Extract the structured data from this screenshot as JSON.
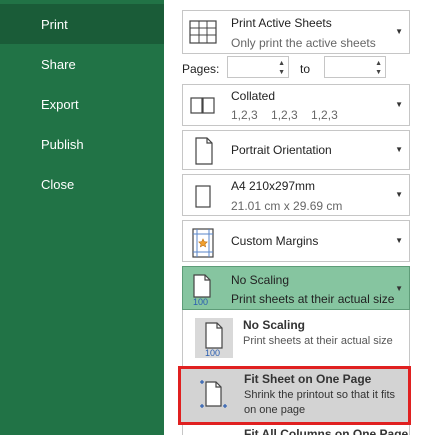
{
  "sidebar": {
    "items": [
      {
        "label": "Print",
        "active": true
      },
      {
        "label": "Share",
        "active": false
      },
      {
        "label": "Export",
        "active": false
      },
      {
        "label": "Publish",
        "active": false
      },
      {
        "label": "Close",
        "active": false
      }
    ]
  },
  "settings": {
    "print_what": {
      "label": "Print Active Sheets",
      "description": "Only print the active sheets"
    },
    "pages": {
      "label": "Pages:",
      "from": "",
      "to_label": "to",
      "to": ""
    },
    "collation": {
      "label": "Collated",
      "description": "1,2,3    1,2,3    1,2,3"
    },
    "orientation": {
      "label": "Portrait Orientation"
    },
    "paper_size": {
      "label": "A4 210x297mm",
      "description": "21.01 cm x 29.69 cm"
    },
    "margins": {
      "label": "Custom Margins"
    },
    "scaling": {
      "label": "No Scaling",
      "description": "Print sheets at their actual size"
    }
  },
  "scaling_options": [
    {
      "title": "No Scaling",
      "description": "Print sheets at their actual size",
      "icon_text": "100"
    },
    {
      "title": "Fit Sheet on One Page",
      "description": "Shrink the printout so that it fits on one page"
    },
    {
      "title": "Fit All Columns on One Page"
    }
  ],
  "colors": {
    "sidebar": "#217346",
    "sidebar_active": "#1a5c38",
    "selected_option": "#86c5a0",
    "highlight": "#e02020"
  }
}
